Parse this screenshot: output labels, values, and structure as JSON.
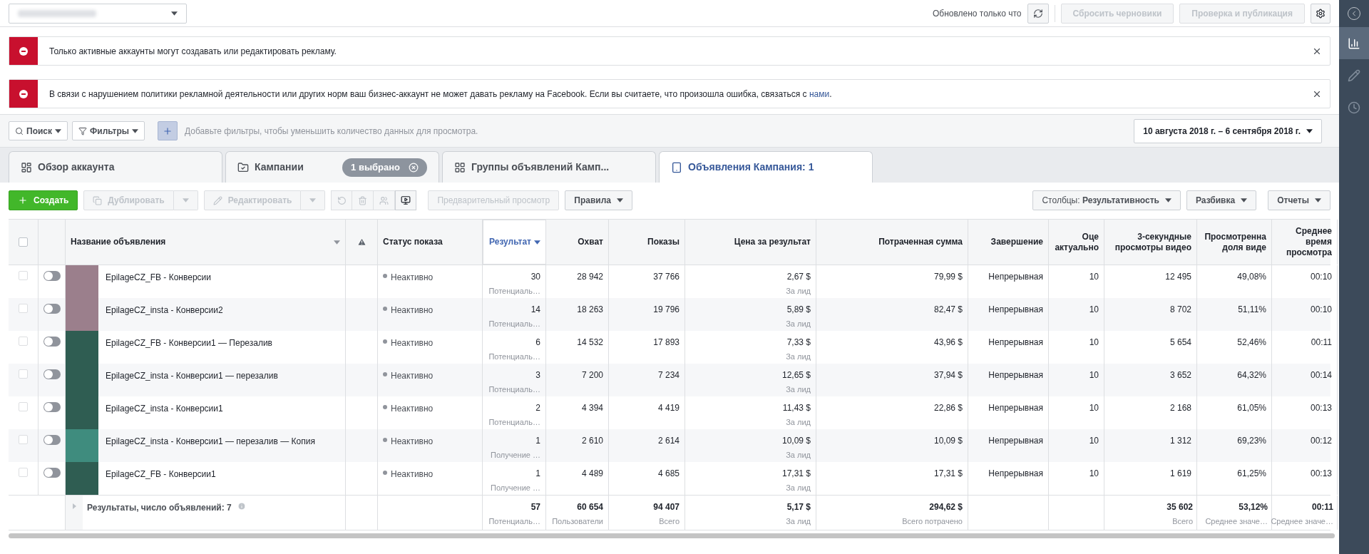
{
  "top_bar": {
    "updated": "Обновлено только что",
    "buttons": [
      {
        "label": "Сбросить черновики",
        "disabled": true
      },
      {
        "label": "Проверка и публикация",
        "disabled": true
      }
    ]
  },
  "alerts": [
    {
      "text": "Только активные аккаунты могут создавать или редактировать рекламу."
    },
    {
      "text": "В связи с нарушением политики рекламной деятельности или других норм ваш бизнес-аккаунт не может давать рекламу на Facebook. Если вы считаете, что произошла ошибка, связаться с",
      "link": "нами",
      "after": "."
    }
  ],
  "filter_bar": {
    "search": "Поиск",
    "filters": "Фильтры",
    "placeholder": "Добавьте фильтры, чтобы уменьшить количество данных для просмотра.",
    "date_range": "10 августа 2018 г. – 6 сентября 2018 г."
  },
  "tabs": [
    {
      "kind": "account",
      "label": "Обзор аккаунта",
      "selected": false
    },
    {
      "kind": "campaigns",
      "label": "Кампании",
      "chip": "1 выбрано",
      "selected": false
    },
    {
      "kind": "groups",
      "label": "Группы объявлений Камп...",
      "selected": false
    },
    {
      "kind": "ads",
      "label": "Объявления Кампания: 1",
      "selected": true
    }
  ],
  "toolbar": {
    "create": "Создать",
    "duplicate": {
      "label": "Дублировать",
      "disabled": true
    },
    "edit": {
      "label": "Редактировать",
      "disabled": true
    },
    "preview": {
      "label": "Предварительный просмотр",
      "disabled": true
    },
    "rules": "Правила",
    "columns_prefix": "Столбцы:",
    "columns_value": "Результативность",
    "breakdown": "Разбивка",
    "reports": "Отчеты"
  },
  "table": {
    "select_all": {
      "checked": false
    },
    "columns": [
      {
        "kind": "name",
        "label": "Название объявления"
      },
      {
        "kind": "warning"
      },
      {
        "kind": "text",
        "label": "Статус показа"
      },
      {
        "kind": "number",
        "label": "Результат",
        "sorted": true
      },
      {
        "kind": "number",
        "label": "Охват",
        "sorted": false
      },
      {
        "kind": "number",
        "label": "Показы",
        "sorted": false
      },
      {
        "kind": "number",
        "label": "Цена за результат",
        "sorted": false
      },
      {
        "kind": "number",
        "label": "Потраченная сумма",
        "sorted": false
      },
      {
        "kind": "number",
        "label": "Завершение",
        "sorted": false
      },
      {
        "kind": "number",
        "label": "Оце актуально",
        "sorted": false
      },
      {
        "kind": "number",
        "label": "3-секундные просмотры видео",
        "sorted": false
      },
      {
        "kind": "number",
        "label": "Просмотренна доля виде",
        "sorted": false
      },
      {
        "kind": "number",
        "label": "Среднее время просмотра",
        "sorted": false
      }
    ],
    "rows": [
      {
        "checked": false,
        "on": false,
        "name": "EpilageCZ_FB - Конверсии",
        "status": "Неактивно",
        "values": [
          {
            "value": "30",
            "sub": "Потенциаль…"
          },
          {
            "value": "28 942"
          },
          {
            "value": "37 766"
          },
          {
            "value": "2,67 $",
            "sub": "За лид"
          },
          {
            "value": "79,99 $"
          },
          {
            "value": "Непрерывная"
          },
          {
            "value": "10"
          },
          {
            "value": "12 495"
          },
          {
            "value": "49,08%"
          },
          {
            "value": "00:10"
          }
        ]
      },
      {
        "checked": false,
        "on": false,
        "name": "EpilageCZ_insta - Конверсии2",
        "status": "Неактивно",
        "values": [
          {
            "value": "14",
            "sub": "Потенциаль…"
          },
          {
            "value": "18 263"
          },
          {
            "value": "19 796"
          },
          {
            "value": "5,89 $",
            "sub": "За лид"
          },
          {
            "value": "82,47 $"
          },
          {
            "value": "Непрерывная"
          },
          {
            "value": "10"
          },
          {
            "value": "8 702"
          },
          {
            "value": "51,11%"
          },
          {
            "value": "00:10"
          }
        ]
      },
      {
        "checked": false,
        "on": false,
        "name": "EpilageCZ_FB - Конверсии1 — Перезалив",
        "status": "Неактивно",
        "values": [
          {
            "value": "6",
            "sub": "Потенциаль…"
          },
          {
            "value": "14 532"
          },
          {
            "value": "17 893"
          },
          {
            "value": "7,33 $",
            "sub": "За лид"
          },
          {
            "value": "43,96 $"
          },
          {
            "value": "Непрерывная"
          },
          {
            "value": "10"
          },
          {
            "value": "5 654"
          },
          {
            "value": "52,46%"
          },
          {
            "value": "00:11"
          }
        ]
      },
      {
        "checked": false,
        "on": false,
        "name": "EpilageCZ_insta - Конверсии1 — перезалив",
        "status": "Неактивно",
        "values": [
          {
            "value": "3",
            "sub": "Потенциаль…"
          },
          {
            "value": "7 200"
          },
          {
            "value": "7 234"
          },
          {
            "value": "12,65 $",
            "sub": "За лид"
          },
          {
            "value": "37,94 $"
          },
          {
            "value": "Непрерывная"
          },
          {
            "value": "10"
          },
          {
            "value": "3 652"
          },
          {
            "value": "64,32%"
          },
          {
            "value": "00:14"
          }
        ]
      },
      {
        "checked": false,
        "on": false,
        "name": "EpilageCZ_insta - Конверсии1",
        "status": "Неактивно",
        "values": [
          {
            "value": "2",
            "sub": "Потенциаль…"
          },
          {
            "value": "4 394"
          },
          {
            "value": "4 419"
          },
          {
            "value": "11,43 $",
            "sub": "За лид"
          },
          {
            "value": "22,86 $"
          },
          {
            "value": "Непрерывная"
          },
          {
            "value": "10"
          },
          {
            "value": "2 168"
          },
          {
            "value": "61,05%"
          },
          {
            "value": "00:13"
          }
        ]
      },
      {
        "checked": false,
        "on": false,
        "name": "EpilageCZ_insta - Конверсии1 — перезалив — Копия",
        "status": "Неактивно",
        "values": [
          {
            "value": "1",
            "sub": "Получение …"
          },
          {
            "value": "2 610"
          },
          {
            "value": "2 614"
          },
          {
            "value": "10,09 $",
            "sub": "За лид"
          },
          {
            "value": "10,09 $"
          },
          {
            "value": "Непрерывная"
          },
          {
            "value": "10"
          },
          {
            "value": "1 312"
          },
          {
            "value": "69,23%"
          },
          {
            "value": "00:12"
          }
        ]
      },
      {
        "checked": false,
        "on": false,
        "name": "EpilageCZ_FB - Конверсии1",
        "status": "Неактивно",
        "values": [
          {
            "value": "1",
            "sub": "Получение …"
          },
          {
            "value": "4 489"
          },
          {
            "value": "4 685"
          },
          {
            "value": "17,31 $",
            "sub": "За лид"
          },
          {
            "value": "17,31 $"
          },
          {
            "value": "Непрерывная"
          },
          {
            "value": "10"
          },
          {
            "value": "1 619"
          },
          {
            "value": "61,25%"
          },
          {
            "value": "00:13"
          }
        ]
      }
    ],
    "footer": {
      "label": "Результаты, число объявлений: 7",
      "values": [
        {
          "value": "57",
          "sub": "Потенциаль…"
        },
        {
          "value": "60 654",
          "sub": "Пользователи"
        },
        {
          "value": "94 407",
          "sub": "Всего"
        },
        {
          "value": "5,17 $",
          "sub": "За лид"
        },
        {
          "value": "294,62 $",
          "sub": "Всего потрачено"
        }
      ],
      "values_right": [
        {
          "value": "35 602",
          "sub": "Всего"
        },
        {
          "value": "53,12%",
          "sub": "Среднее значе…"
        },
        {
          "value": "00:11",
          "sub": "Среднее значе…"
        }
      ]
    }
  },
  "sidebar": {
    "items": [
      {
        "kind": "stats",
        "selected": true
      },
      {
        "kind": "edit",
        "selected": false
      },
      {
        "kind": "history",
        "selected": false
      }
    ]
  }
}
